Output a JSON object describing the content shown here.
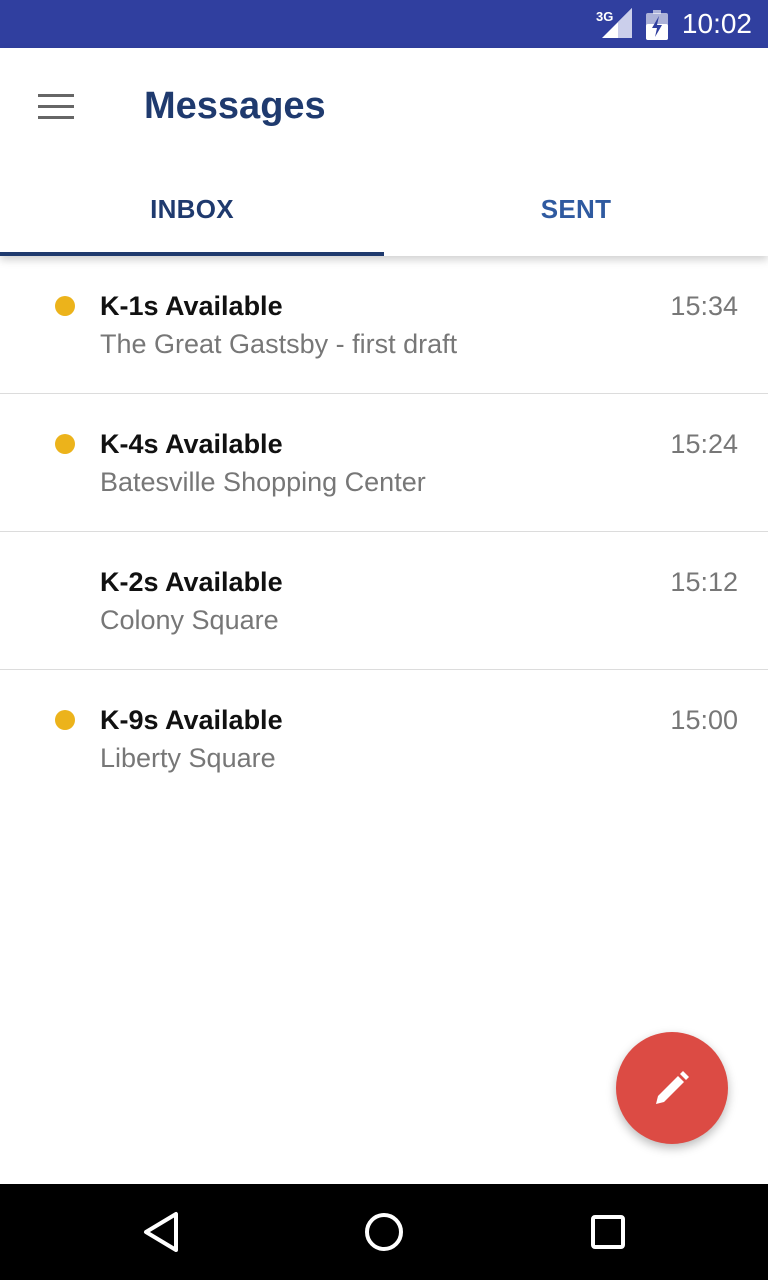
{
  "status_bar": {
    "network": "3G",
    "time": "10:02",
    "icons": [
      "signal-icon",
      "battery-icon"
    ]
  },
  "app_bar": {
    "title": "Messages",
    "menu_icon": "hamburger-menu-icon"
  },
  "tabs": [
    {
      "label": "INBOX",
      "selected": true
    },
    {
      "label": "SENT",
      "selected": false
    }
  ],
  "messages": [
    {
      "title": "K-1s Available",
      "subtitle": "The Great Gastsby - first draft",
      "time": "15:34",
      "unread": true
    },
    {
      "title": "K-4s Available",
      "subtitle": "Batesville Shopping Center",
      "time": "15:24",
      "unread": true
    },
    {
      "title": "K-2s Available",
      "subtitle": "Colony Square",
      "time": "15:12",
      "unread": false
    },
    {
      "title": "K-9s Available",
      "subtitle": "Liberty Square",
      "time": "15:00",
      "unread": true
    }
  ],
  "fab": {
    "icon": "pencil-icon"
  },
  "nav_bar": {
    "icons": [
      "back-icon",
      "home-icon",
      "recents-icon"
    ]
  },
  "colors": {
    "status_bar": "#303f9f",
    "primary_text": "#1f3a6e",
    "tab_text": "#2f5aa0",
    "unread_dot": "#ecb31b",
    "fab": "#dc4b44"
  }
}
